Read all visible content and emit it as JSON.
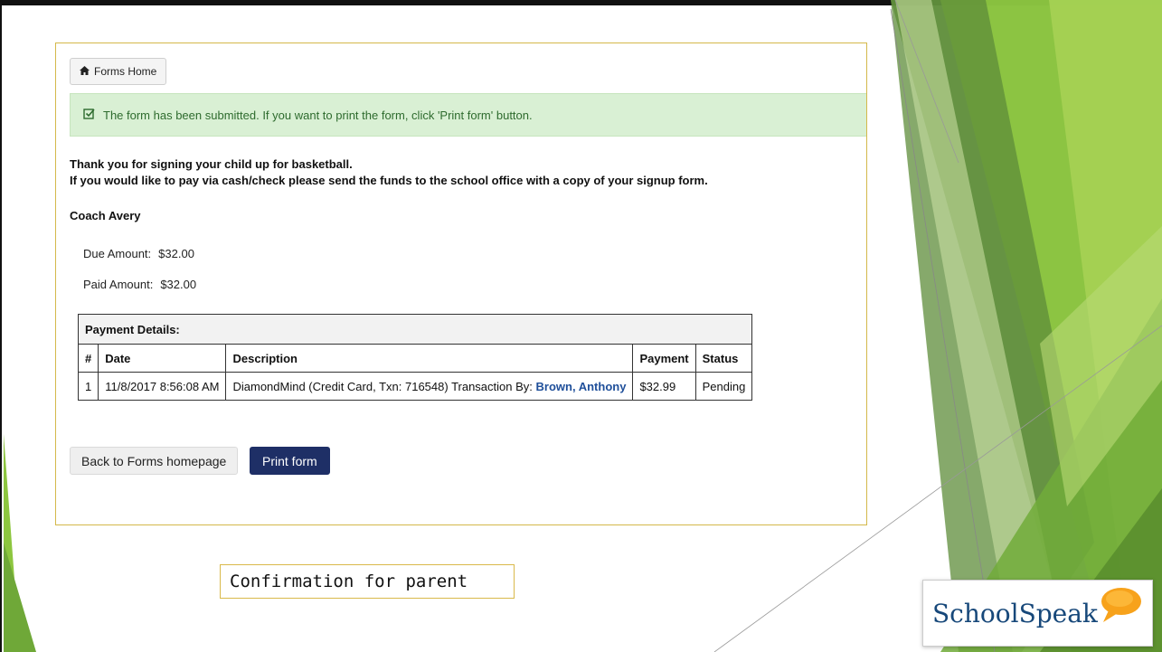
{
  "forms_home_label": "Forms Home",
  "alert_text": "The form has been submitted. If you want to print the form, click 'Print form' button.",
  "message_lines": [
    "Thank you for signing your child up for basketball.",
    "If you would like to pay via cash/check please send the funds to the school office with a copy of your signup form."
  ],
  "signature": "Coach Avery",
  "due_label": "Due Amount:",
  "due_value": "$32.00",
  "paid_label": "Paid Amount:",
  "paid_value": "$32.00",
  "payment_table": {
    "caption": "Payment Details:",
    "headers": [
      "#",
      "Date",
      "Description",
      "Payment",
      "Status"
    ],
    "rows": [
      {
        "num": "1",
        "date": "11/8/2017 8:56:08 AM",
        "description": "DiamondMind (Credit Card, Txn: 716548) Transaction By:",
        "transaction_by": "Brown, Anthony",
        "payment": "$32.99",
        "status": "Pending"
      }
    ]
  },
  "back_button_label": "Back to Forms homepage",
  "print_button_label": "Print form",
  "slide_caption": "Confirmation for parent",
  "logo_text": "SchoolSpeak",
  "colors": {
    "primary_button": "#1e2f66",
    "alert_bg": "#d9f0d4",
    "alert_text": "#2e6b2e",
    "link": "#1f4f9a",
    "accent_green": "#8dc63f"
  },
  "icons": [
    "home-icon",
    "check-square-icon",
    "speech-bubble-icon"
  ]
}
